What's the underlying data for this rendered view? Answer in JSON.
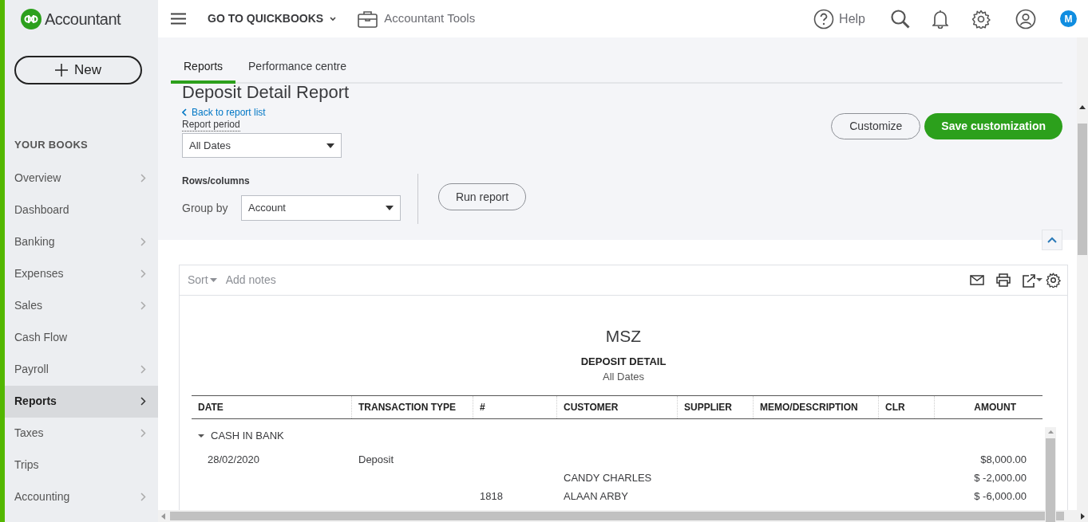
{
  "brand": {
    "name": "Accountant"
  },
  "new_button": {
    "label": "New"
  },
  "sidebar": {
    "section_title": "YOUR BOOKS",
    "items": [
      {
        "label": "Overview",
        "has_submenu": true,
        "selected": false
      },
      {
        "label": "Dashboard",
        "has_submenu": false,
        "selected": false
      },
      {
        "label": "Banking",
        "has_submenu": true,
        "selected": false
      },
      {
        "label": "Expenses",
        "has_submenu": true,
        "selected": false
      },
      {
        "label": "Sales",
        "has_submenu": true,
        "selected": false
      },
      {
        "label": "Cash Flow",
        "has_submenu": false,
        "selected": false
      },
      {
        "label": "Payroll",
        "has_submenu": true,
        "selected": false
      },
      {
        "label": "Reports",
        "has_submenu": true,
        "selected": true
      },
      {
        "label": "Taxes",
        "has_submenu": true,
        "selected": false
      },
      {
        "label": "Trips",
        "has_submenu": false,
        "selected": false
      },
      {
        "label": "Accounting",
        "has_submenu": true,
        "selected": false
      }
    ]
  },
  "top_bar": {
    "switcher": "GO TO QUICKBOOKS",
    "tools": "Accountant Tools",
    "help": "Help",
    "avatar": "M"
  },
  "tabs": [
    {
      "label": "Reports",
      "selected": true
    },
    {
      "label": "Performance centre",
      "selected": false
    }
  ],
  "page": {
    "title": "Deposit Detail Report",
    "back_link": "Back to report list",
    "period_label": "Report period",
    "period_value": "All Dates",
    "rows_columns_label": "Rows/columns",
    "group_by_label": "Group by",
    "group_by_value": "Account",
    "run_button": "Run report",
    "customize_button": "Customize",
    "save_button": "Save customization"
  },
  "report": {
    "toolbar": {
      "sort": "Sort",
      "add_notes": "Add notes"
    },
    "company": "MSZ",
    "title": "DEPOSIT DETAIL",
    "period": "All Dates",
    "columns": [
      "DATE",
      "TRANSACTION TYPE",
      "#",
      "CUSTOMER",
      "SUPPLIER",
      "MEMO/DESCRIPTION",
      "CLR",
      "AMOUNT"
    ],
    "groups": [
      {
        "name": "CASH IN BANK",
        "expanded": true,
        "rows": [
          [
            "28/02/2020",
            "Deposit",
            "",
            "",
            "",
            "",
            "",
            "$8,000.00"
          ],
          [
            "",
            "",
            "",
            "CANDY CHARLES",
            "",
            "",
            "",
            "$ -2,000.00"
          ],
          [
            "",
            "",
            "1818",
            "ALAAN ARBY",
            "",
            "",
            "",
            "$ -6,000.00"
          ]
        ]
      }
    ]
  }
}
